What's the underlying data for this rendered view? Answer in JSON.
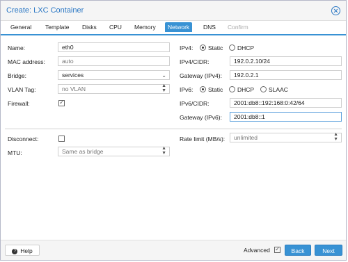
{
  "window": {
    "title": "Create: LXC Container"
  },
  "tabs": [
    "General",
    "Template",
    "Disks",
    "CPU",
    "Memory",
    "Network",
    "DNS",
    "Confirm"
  ],
  "left": {
    "name": {
      "label": "Name:",
      "value": "eth0"
    },
    "mac": {
      "label": "MAC address:",
      "placeholder": "auto"
    },
    "bridge": {
      "label": "Bridge:",
      "value": "services"
    },
    "vlan": {
      "label": "VLAN Tag:",
      "placeholder": "no VLAN"
    },
    "firewall": {
      "label": "Firewall:",
      "checked": true
    }
  },
  "right": {
    "ipv4": {
      "label": "IPv4:",
      "options": [
        "Static",
        "DHCP"
      ],
      "selected": "Static"
    },
    "ipv4_cidr": {
      "label": "IPv4/CIDR:",
      "value": "192.0.2.10/24"
    },
    "gateway4": {
      "label": "Gateway (IPv4):",
      "value": "192.0.2.1"
    },
    "ipv6": {
      "label": "IPv6:",
      "options": [
        "Static",
        "DHCP",
        "SLAAC"
      ],
      "selected": "Static"
    },
    "ipv6_cidr": {
      "label": "IPv6/CIDR:",
      "value": "2001:db8::192:168:0:42/64"
    },
    "gateway6": {
      "label": "Gateway (IPv6):",
      "value": "2001:db8::1"
    }
  },
  "advanced": {
    "disconnect": {
      "label": "Disconnect:",
      "checked": false
    },
    "mtu": {
      "label": "MTU:",
      "placeholder": "Same as bridge"
    },
    "rate": {
      "label": "Rate limit (MB/s):",
      "placeholder": "unlimited"
    }
  },
  "footer": {
    "help": "Help",
    "advanced": "Advanced",
    "back": "Back",
    "next": "Next"
  }
}
